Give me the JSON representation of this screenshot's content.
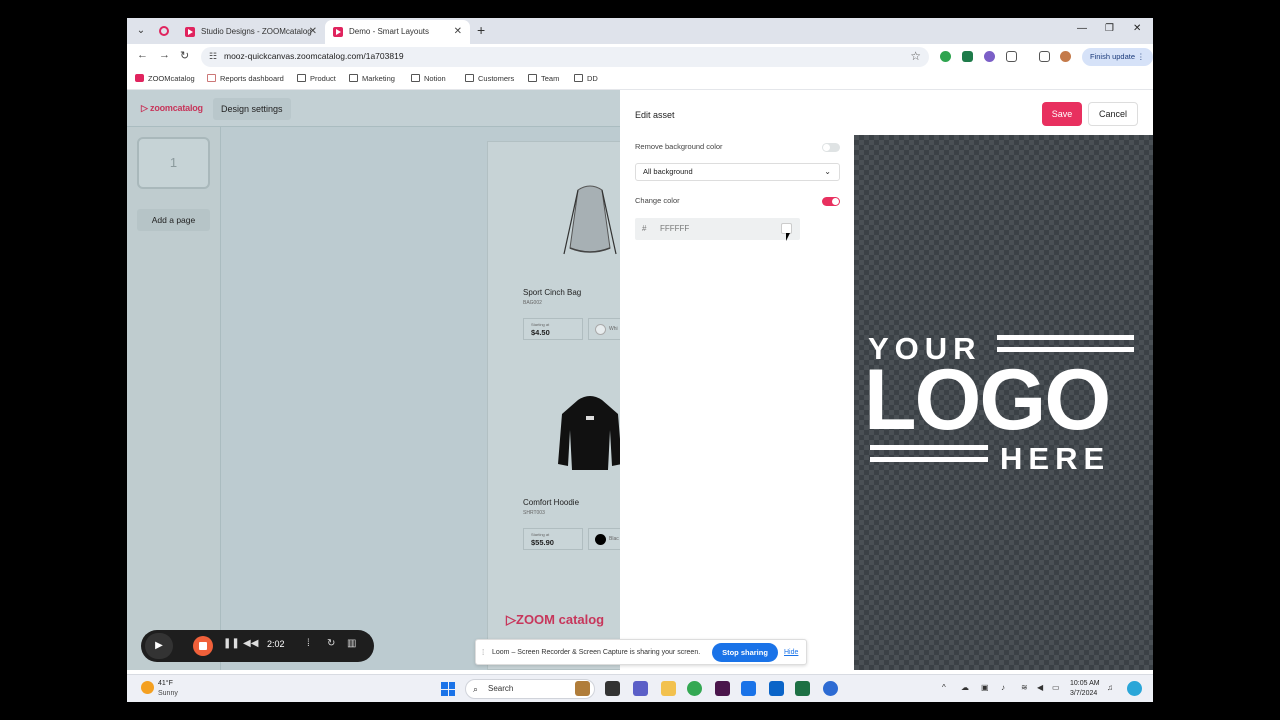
{
  "browser": {
    "tabs": [
      {
        "label": "Studio Designs - ZOOMcatalog",
        "active": false
      },
      {
        "label": "Demo - Smart Layouts",
        "active": true
      }
    ],
    "url": "mooz-quickcanvas.zoomcatalog.com/1a703819",
    "finish_update": "Finish update",
    "bookmarks": [
      "ZOOMcatalog",
      "Reports dashboard",
      "Product",
      "Marketing",
      "Notion",
      "Customers",
      "Team",
      "DD"
    ]
  },
  "app": {
    "brand": "zoomcatalog",
    "design_settings": "Design settings",
    "page_number": "1",
    "add_page": "Add a page",
    "products": [
      {
        "name": "Sport Cinch Bag",
        "sku": "BAG002",
        "price_label": "Starting at",
        "price": "$4.50",
        "color": "Whi",
        "color_hex": "#e7ecee"
      },
      {
        "name": "Comfort Hoodie",
        "sku": "SHRT003",
        "price_label": "Starting at",
        "price": "$55.90",
        "color": "Blac",
        "color_hex": "#000000"
      }
    ],
    "footer_brand": "ZOOM catalog"
  },
  "edit_panel": {
    "title": "Edit asset",
    "save": "Save",
    "cancel": "Cancel",
    "remove_bg_label": "Remove background color",
    "remove_bg_on": false,
    "scope_select": "All background",
    "change_color_label": "Change color",
    "change_color_on": true,
    "hash": "#",
    "hex_placeholder": "FFFFFF",
    "accent_color": "#e8305f",
    "preview": {
      "line1": "YOUR",
      "line2": "LOGO",
      "line3": "HERE"
    }
  },
  "recorder": {
    "time": "2:02"
  },
  "share_bar": {
    "message": "Loom – Screen Recorder & Screen Capture is sharing your screen.",
    "stop": "Stop sharing",
    "hide": "Hide"
  },
  "taskbar": {
    "temp": "41°F",
    "condition": "Sunny",
    "search": "Search",
    "time": "10:05 AM",
    "date": "3/7/2024"
  }
}
